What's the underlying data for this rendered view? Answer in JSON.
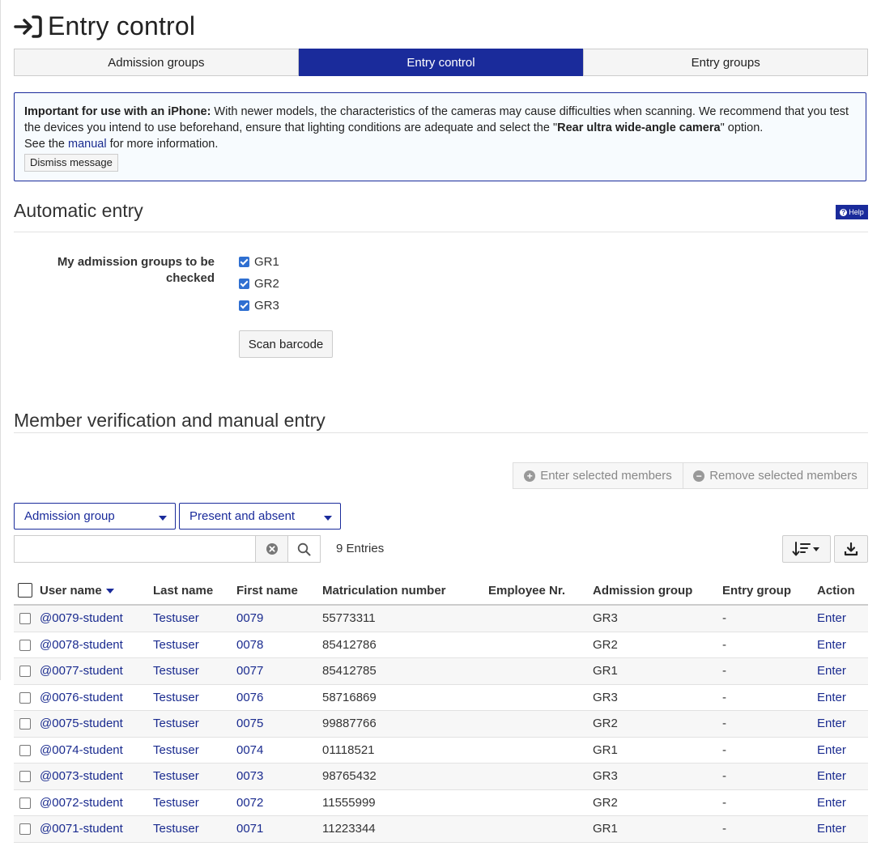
{
  "page": {
    "title": "Entry control"
  },
  "tabs": [
    {
      "label": "Admission groups"
    },
    {
      "label": "Entry control"
    },
    {
      "label": "Entry groups"
    }
  ],
  "alert": {
    "strong": "Important for use with an iPhone:",
    "text1": " With newer models, the characteristics of the cameras may cause difficulties when scanning. We recommend that you test the devices you intend to use beforehand, ensure that lighting conditions are adequate and select the \"",
    "camera": "Rear ultra wide-angle camera",
    "text2": "\" option.",
    "see": "See the ",
    "manual_link": "manual",
    "more": " for more information.",
    "dismiss_label": "Dismiss message"
  },
  "automatic": {
    "title": "Automatic entry",
    "help_label": "Help",
    "groups_label": "My admission groups to be checked",
    "groups": [
      {
        "label": "GR1",
        "checked": true
      },
      {
        "label": "GR2",
        "checked": true
      },
      {
        "label": "GR3",
        "checked": true
      }
    ],
    "scan_label": "Scan barcode"
  },
  "verification": {
    "title": "Member verification and manual entry",
    "enter_selected": "Enter selected members",
    "remove_selected": "Remove selected members",
    "filter_group": "Admission group",
    "filter_presence": "Present and absent",
    "search_placeholder": "",
    "entries": "9 Entries"
  },
  "table": {
    "columns": [
      "User name",
      "Last name",
      "First name",
      "Matriculation number",
      "Employee Nr.",
      "Admission group",
      "Entry group",
      "Action"
    ],
    "rows": [
      {
        "user": "@0079-student",
        "last": "Testuser",
        "first": "0079",
        "matric": "55773311",
        "employee": "",
        "group": "GR3",
        "entry": "-",
        "action": "Enter"
      },
      {
        "user": "@0078-student",
        "last": "Testuser",
        "first": "0078",
        "matric": "85412786",
        "employee": "",
        "group": "GR2",
        "entry": "-",
        "action": "Enter"
      },
      {
        "user": "@0077-student",
        "last": "Testuser",
        "first": "0077",
        "matric": "85412785",
        "employee": "",
        "group": "GR1",
        "entry": "-",
        "action": "Enter"
      },
      {
        "user": "@0076-student",
        "last": "Testuser",
        "first": "0076",
        "matric": "58716869",
        "employee": "",
        "group": "GR3",
        "entry": "-",
        "action": "Enter"
      },
      {
        "user": "@0075-student",
        "last": "Testuser",
        "first": "0075",
        "matric": "99887766",
        "employee": "",
        "group": "GR2",
        "entry": "-",
        "action": "Enter"
      },
      {
        "user": "@0074-student",
        "last": "Testuser",
        "first": "0074",
        "matric": "01118521",
        "employee": "",
        "group": "GR1",
        "entry": "-",
        "action": "Enter"
      },
      {
        "user": "@0073-student",
        "last": "Testuser",
        "first": "0073",
        "matric": "98765432",
        "employee": "",
        "group": "GR3",
        "entry": "-",
        "action": "Enter"
      },
      {
        "user": "@0072-student",
        "last": "Testuser",
        "first": "0072",
        "matric": "11555999",
        "employee": "",
        "group": "GR2",
        "entry": "-",
        "action": "Enter"
      },
      {
        "user": "@0071-student",
        "last": "Testuser",
        "first": "0071",
        "matric": "11223344",
        "employee": "",
        "group": "GR1",
        "entry": "-",
        "action": "Enter"
      }
    ]
  },
  "colors": {
    "primary": "#1a2b9b",
    "link": "#1a2b8f",
    "checkbox": "#2f6fd1"
  }
}
